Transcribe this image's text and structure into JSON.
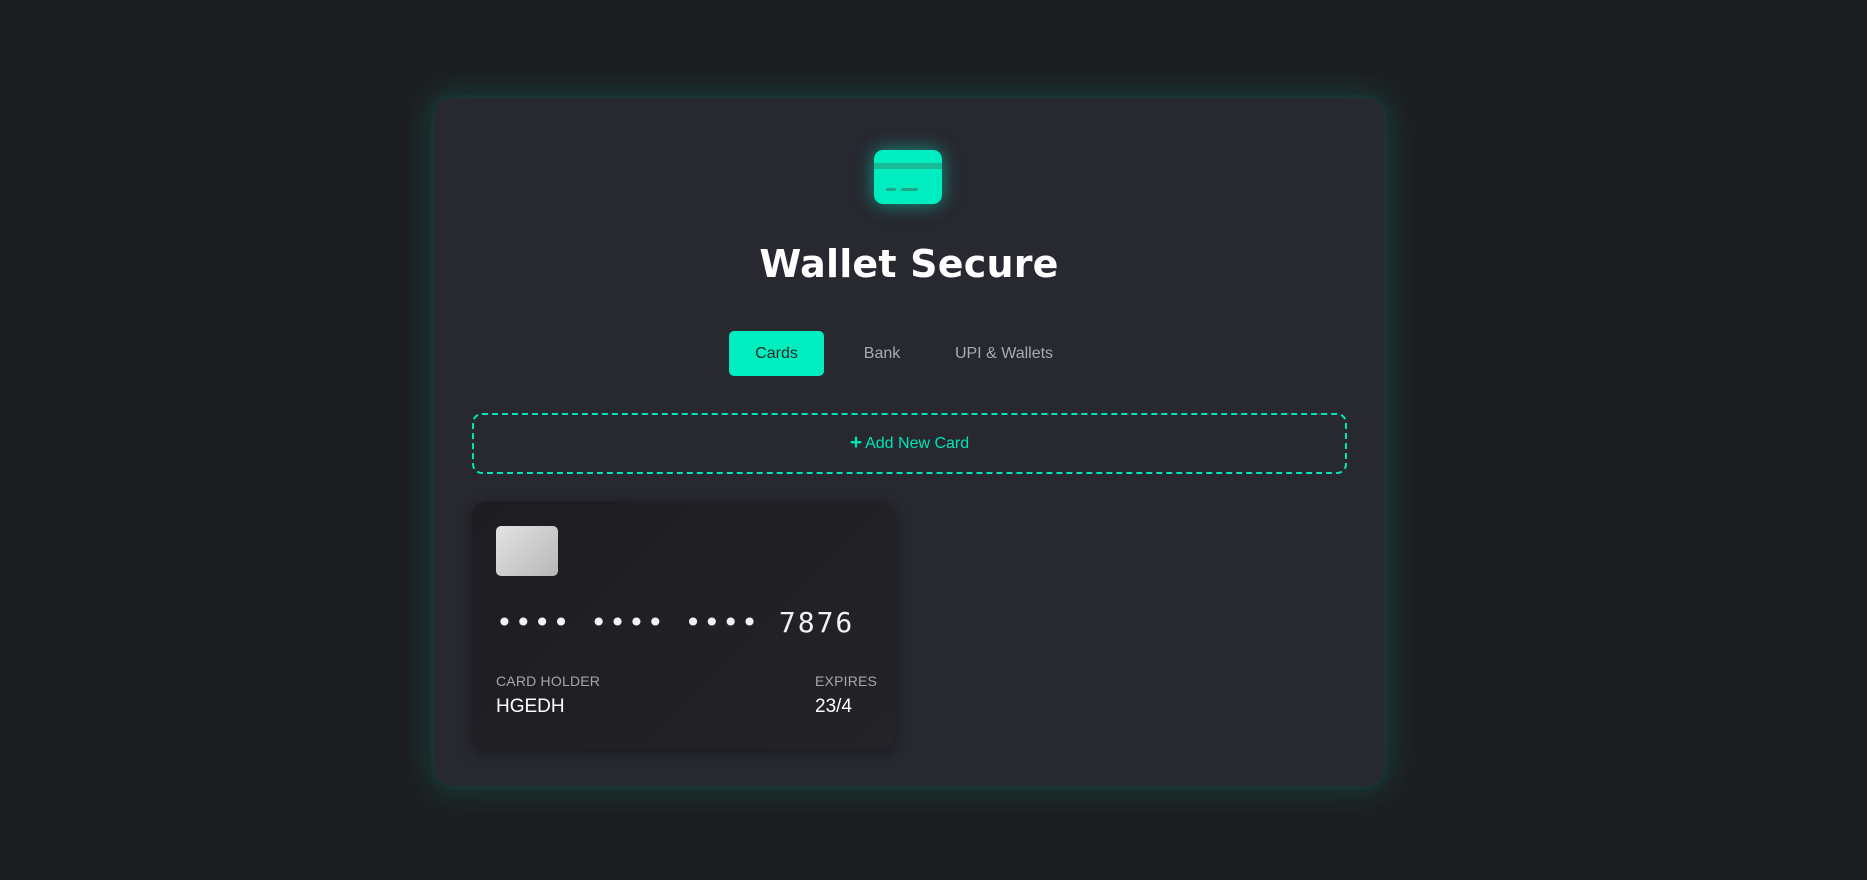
{
  "app": {
    "title": "Wallet Secure",
    "icon": "credit-card-icon",
    "accent_color": "#00edc0",
    "background_color": "#1c1d21",
    "panel_color": "#272830"
  },
  "tabs": [
    {
      "label": "Cards",
      "active": true
    },
    {
      "label": "Bank",
      "active": false
    },
    {
      "label": "UPI & Wallets",
      "active": false
    }
  ],
  "add_card": {
    "icon": "plus-icon",
    "plus": "+",
    "label": "Add New Card"
  },
  "card": {
    "number": "•••• •••• •••• 7876",
    "holder_label": "CARD HOLDER",
    "holder_name": "HGEDH",
    "expires_label": "EXPIRES",
    "expires": "23/4"
  }
}
